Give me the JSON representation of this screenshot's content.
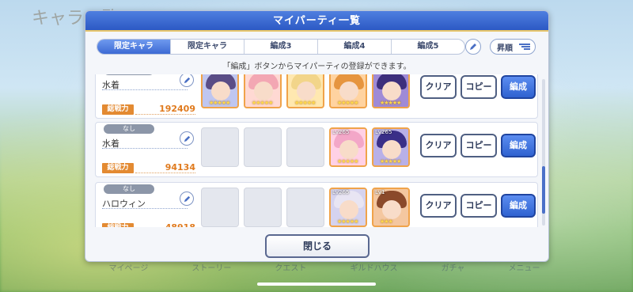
{
  "background": {
    "title": "キャラ一覧",
    "bottom_nav": [
      "マイページ",
      "ストーリー",
      "クエスト",
      "ギルドハウス",
      "ガチャ",
      "メニュー"
    ]
  },
  "dialog": {
    "title": "マイパーティ一覧",
    "tabs": [
      "限定キャラ",
      "限定キャラ",
      "編成3",
      "編成4",
      "編成5"
    ],
    "active_tab": 0,
    "sort_label": "昇順",
    "notice": "「編成」ボタンからマイパーティの登録ができます。",
    "close_label": "閉じる"
  },
  "parties": [
    {
      "tag": "なし",
      "name": "水着",
      "power_label": "総戦力",
      "power": "192409",
      "chars": [
        {
          "lv": "",
          "stars": "★★★★★",
          "hair": "#5a4d86",
          "bg": "#bfc6f0"
        },
        {
          "lv": "",
          "stars": "★★★★★",
          "hair": "#f3a7b3",
          "bg": "#ffd9d3"
        },
        {
          "lv": "",
          "stars": "★★★★★",
          "hair": "#f2d58a",
          "bg": "#ffe8b0"
        },
        {
          "lv": "",
          "stars": "★★★★★",
          "hair": "#e6953f",
          "bg": "#ffd3a0"
        },
        {
          "lv": "",
          "stars": "★★★★★",
          "hair": "#3d2f7c",
          "bg": "#9f8ad6"
        }
      ]
    },
    {
      "tag": "なし",
      "name": "水着",
      "power_label": "総戦力",
      "power": "94134",
      "chars": [
        {
          "lv": "Lv265",
          "stars": "★★★★★",
          "hair": "#f3a7c8",
          "bg": "#ffd1e6"
        },
        {
          "lv": "Lv265",
          "stars": "★★★★★",
          "hair": "#3a2f88",
          "bg": "#b8b0e8"
        }
      ]
    },
    {
      "tag": "なし",
      "name": "ハロウィン",
      "power_label": "総戦力",
      "power": "48918",
      "chars": [
        {
          "lv": "Lv265",
          "stars": "★★★★★",
          "hair": "#e8e5f3",
          "bg": "#d5d3ef"
        },
        {
          "lv": "Lv1",
          "stars": "★★★",
          "hair": "#8b4a2b",
          "bg": "#f4c7a0"
        }
      ]
    }
  ],
  "buttons": {
    "clear": "クリア",
    "copy": "コピー",
    "edit": "編成"
  }
}
